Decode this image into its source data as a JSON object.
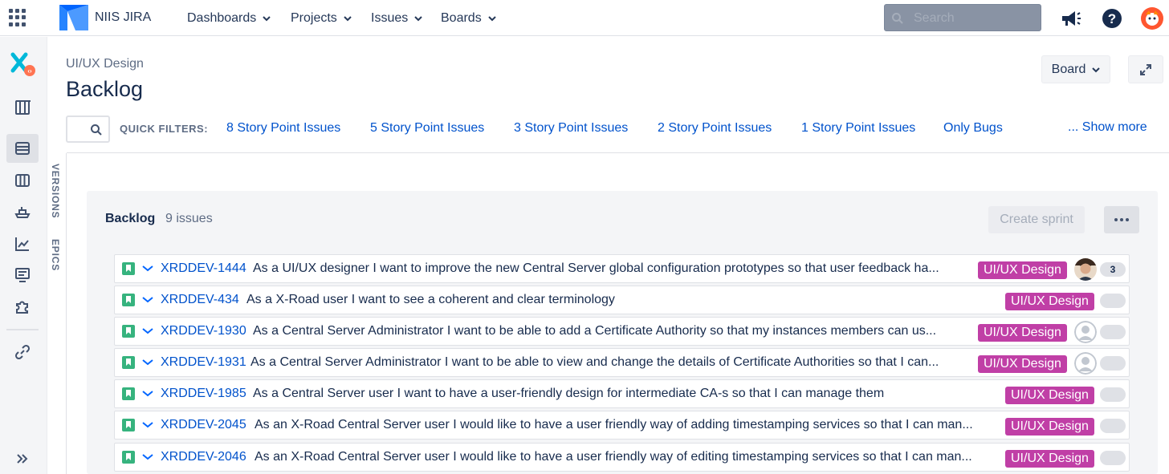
{
  "topbar": {
    "site_name": "NIIS JIRA",
    "nav": [
      {
        "label": "Dashboards"
      },
      {
        "label": "Projects"
      },
      {
        "label": "Issues"
      },
      {
        "label": "Boards"
      }
    ],
    "search_placeholder": "Search"
  },
  "sidebar": {
    "icons": [
      "project-logo-icon",
      "board-icon",
      "backlog-icon",
      "columns-icon",
      "releases-icon",
      "reports-icon",
      "issues-icon",
      "addons-icon",
      "link-icon",
      "expand-sidebar-icon"
    ]
  },
  "vertical_tabs": {
    "versions": "VERSIONS",
    "epics": "EPICS"
  },
  "header": {
    "breadcrumb": "UI/UX Design",
    "title": "Backlog",
    "board_button": "Board"
  },
  "quick_filters": {
    "label": "QUICK FILTERS:",
    "items": [
      {
        "label": "8 Story Point Issues"
      },
      {
        "label": "5 Story Point Issues"
      },
      {
        "label": "3 Story Point Issues"
      },
      {
        "label": "2 Story Point Issues"
      },
      {
        "label": "1 Story Point Issues"
      },
      {
        "label": "Only Bugs"
      }
    ],
    "show_more": "... Show more"
  },
  "backlog": {
    "title": "Backlog",
    "count": "9 issues",
    "create_sprint": "Create sprint",
    "issues": [
      {
        "key": "XRDDEV-1444",
        "summary": "As a UI/UX designer I want to improve the new Central Server global configuration prototypes so that user feedback ha...",
        "epic": "UI/UX Design",
        "assignee": "photo",
        "points": "3"
      },
      {
        "key": "XRDDEV-434",
        "summary": "As a X-Road user I want to see a coherent and clear terminology",
        "epic": "UI/UX Design",
        "assignee": "",
        "points": ""
      },
      {
        "key": "XRDDEV-1930",
        "summary": "As a Central Server Administrator I want to be able to add a Certificate Authority so that my instances members can us...",
        "epic": "UI/UX Design",
        "assignee": "default",
        "points": ""
      },
      {
        "key": "XRDDEV-1931",
        "summary": "As a Central Server Administrator I want to be able to view and change the details of Certificate Authorities so that I can...",
        "epic": "UI/UX Design",
        "assignee": "default",
        "points": ""
      },
      {
        "key": "XRDDEV-1985",
        "summary": "As a Central Server user I want to have a user-friendly design for intermediate CA-s so that I can manage them",
        "epic": "UI/UX Design",
        "assignee": "",
        "points": ""
      },
      {
        "key": "XRDDEV-2045",
        "summary": "As an X-Road Central Server user I would like to have a user friendly way of adding timestamping services so that I can man...",
        "epic": "UI/UX Design",
        "assignee": "",
        "points": ""
      },
      {
        "key": "XRDDEV-2046",
        "summary": "As an X-Road Central Server user I would like to have a user friendly way of editing timestamping services so that I can man...",
        "epic": "UI/UX Design",
        "assignee": "",
        "points": ""
      }
    ]
  },
  "colors": {
    "link": "#0052cc",
    "epic": "#c03fa6",
    "story": "#36b37e",
    "text": "#172b4d"
  }
}
